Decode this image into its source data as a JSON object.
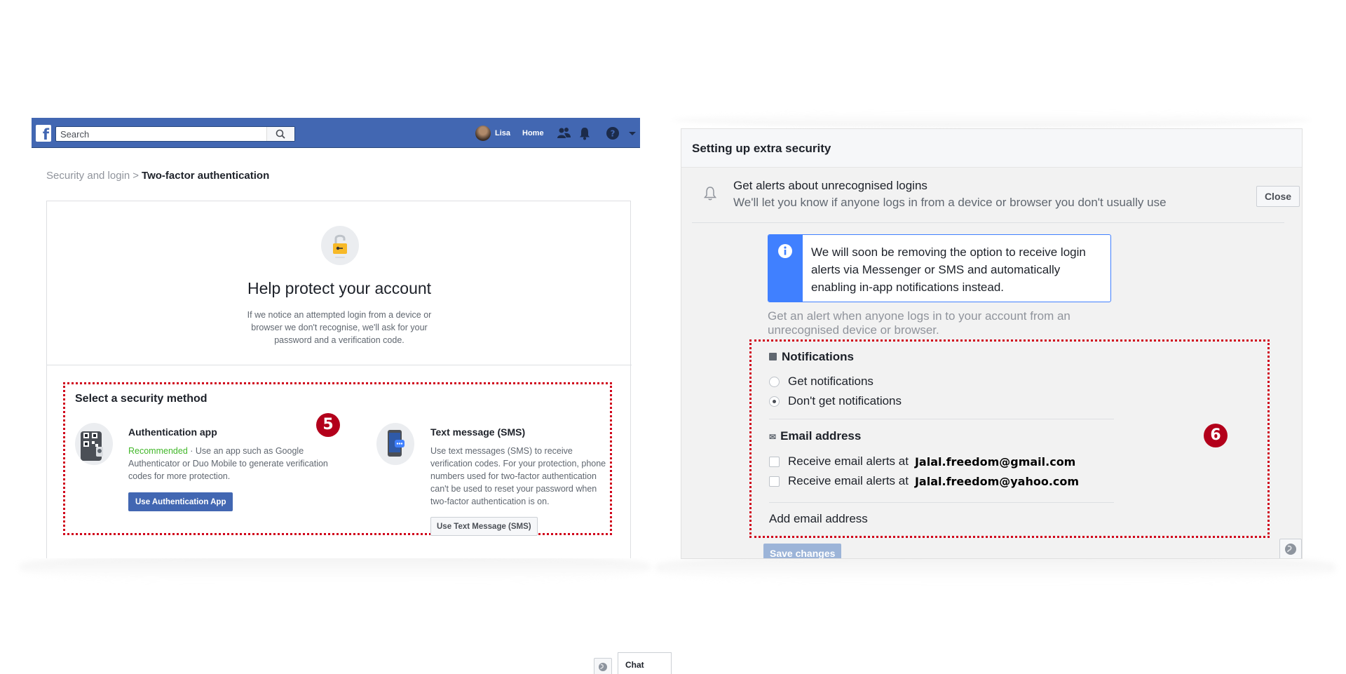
{
  "left": {
    "topbar": {
      "logo": "f",
      "search_placeholder": "Search",
      "user_name": "Lisa",
      "home_label": "Home",
      "icons": [
        "search-icon",
        "friends-icon",
        "bell-icon",
        "help-icon",
        "caret-down-icon"
      ],
      "brand_color": "#4267b2"
    },
    "breadcrumb": {
      "parent": "Security and login",
      "separator": ">",
      "current": "Two-factor authentication"
    },
    "hero": {
      "title": "Help protect your account",
      "description": "If we notice an attempted login from a device or browser we don't recognise, we'll ask for your password and a verification code."
    },
    "methods": {
      "title": "Select a security method",
      "auth_app": {
        "title": "Authentication app",
        "recommended": "Recommended",
        "description": " · Use an app such as Google Authenticator or Duo Mobile to generate verification codes for more protection.",
        "button": "Use Authentication App"
      },
      "sms": {
        "title": "Text message (SMS)",
        "description": "Use text messages (SMS) to receive verification codes. For your protection, phone numbers used for two-factor authentication can't be used to reset your password when two-factor authentication is on.",
        "button": "Use Text Message (SMS)"
      }
    },
    "badge": "5",
    "chat_label": "Chat"
  },
  "right": {
    "title": "Setting up extra security",
    "alerts": {
      "title": "Get alerts about unrecognised logins",
      "subtitle": "We'll let you know if anyone logs in from a device or browser you don't usually use",
      "close_label": "Close"
    },
    "info": "We will soon be removing the option to receive login alerts via Messenger or SMS and automatically enabling in-app notifications instead.",
    "alert_description": "Get an alert when anyone logs in to your account from an unrecognised device or browser.",
    "notifications": {
      "heading": "Notifications",
      "options": [
        {
          "label": "Get notifications",
          "selected": false
        },
        {
          "label": "Don't get notifications",
          "selected": true
        }
      ]
    },
    "email": {
      "heading": "Email address",
      "prefix": "Receive email alerts at",
      "addresses": [
        "Jalal.freedom@gmail.com",
        "Jalal.freedom@yahoo.com"
      ],
      "add_label": "Add email address"
    },
    "save_label": "Save changes",
    "badge": "6",
    "accent_color": "#4080ff",
    "highlight_color": "#d0021b"
  }
}
